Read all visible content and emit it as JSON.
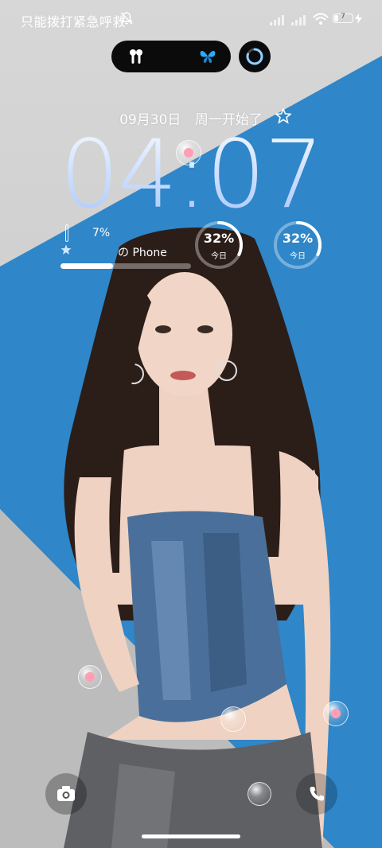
{
  "status_bar": {
    "carrier_text": "只能拨打紧急呼救",
    "battery_level": "7",
    "icons": [
      "bell-off-icon",
      "signal-icon",
      "signal-icon",
      "wifi-icon",
      "battery-icon",
      "charge-icon"
    ]
  },
  "island": {
    "left_icon": "earbuds-icon",
    "right_icon": "butterfly-icon",
    "accent": "#2aa9ff"
  },
  "lockscreen": {
    "date": "09月30日",
    "weekday_text": "周一开始了",
    "clock": "04:07"
  },
  "widget_left": {
    "percent": "7%",
    "device": "の Phone",
    "progress": 0.4
  },
  "rings": [
    {
      "value": "32%",
      "label": "今日",
      "fraction": 0.32
    },
    {
      "value": "32%",
      "label": "今日",
      "fraction": 0.32
    }
  ],
  "bottom": {
    "left_icon": "camera-icon",
    "right_icon": "phone-icon"
  },
  "colors": {
    "wall_blue": "#2f86c8",
    "clock_gradient_top": "#f2f7ff",
    "clock_gradient_bottom": "#a9c8ff"
  }
}
